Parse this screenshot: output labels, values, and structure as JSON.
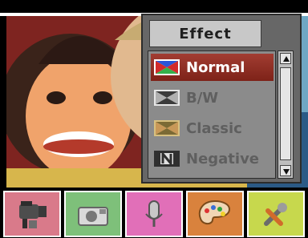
{
  "effect_menu": {
    "title": "Effect",
    "items": [
      {
        "label": "Normal",
        "icon": "normal-effect-icon",
        "selected": true
      },
      {
        "label": "B/W",
        "icon": "bw-effect-icon",
        "selected": false
      },
      {
        "label": "Classic",
        "icon": "classic-effect-icon",
        "selected": false
      },
      {
        "label": "Negative",
        "icon": "negative-effect-icon",
        "selected": false
      }
    ]
  },
  "toolbar": {
    "tools": [
      {
        "name": "video-mode",
        "icon": "video-camera-icon",
        "color": "#d97a8a"
      },
      {
        "name": "photo-mode",
        "icon": "camera-icon",
        "color": "#7ec07a"
      },
      {
        "name": "audio-mode",
        "icon": "microphone-icon",
        "color": "#e16fb8"
      },
      {
        "name": "effect-mode",
        "icon": "palette-icon",
        "color": "#d9823d"
      },
      {
        "name": "settings-mode",
        "icon": "tools-icon",
        "color": "#c7d84d"
      }
    ]
  },
  "colors": {
    "selected_item": "#8a2a20",
    "panel_bg": "#676767"
  }
}
